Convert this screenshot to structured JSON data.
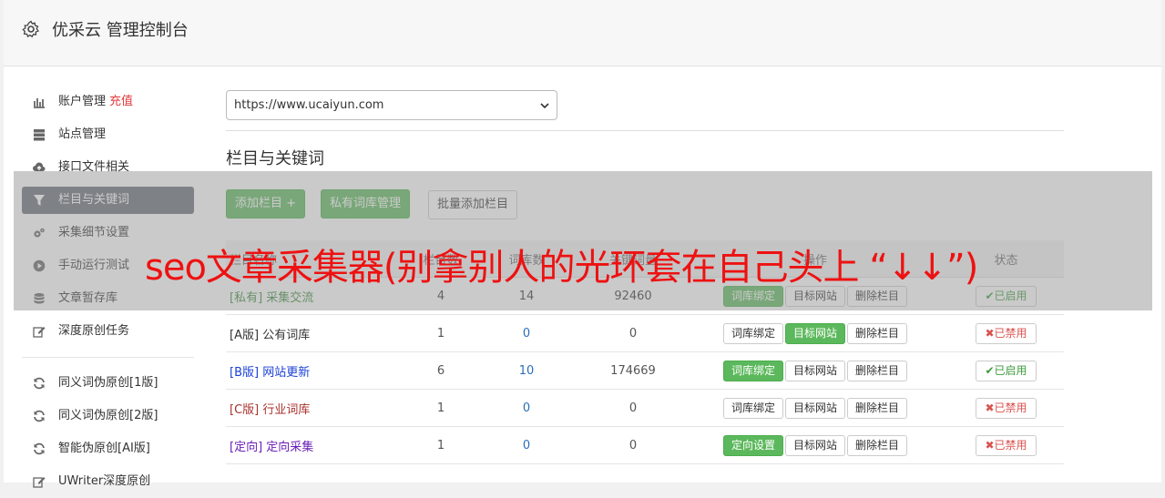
{
  "app": {
    "title": "优采云 管理控制台",
    "icon": "gear-icon"
  },
  "sidebar": {
    "items": [
      {
        "label": "账户管理",
        "extra": "充值",
        "icon": "bar-chart-icon"
      },
      {
        "label": "站点管理",
        "icon": "server-icon"
      },
      {
        "label": "接口文件相关",
        "icon": "cloud-upload-icon"
      },
      {
        "label": "栏目与关键词",
        "icon": "filter-icon",
        "active": true
      },
      {
        "label": "采集细节设置",
        "icon": "cogs-icon"
      },
      {
        "label": "手动运行测试",
        "icon": "play-circle-icon"
      },
      {
        "label": "文章暂存库",
        "icon": "database-icon"
      },
      {
        "label": "深度原创任务",
        "icon": "edit-icon"
      }
    ],
    "items2": [
      {
        "label": "同义词伪原创[1版]",
        "icon": "refresh-icon"
      },
      {
        "label": "同义词伪原创[2版]",
        "icon": "refresh-icon"
      },
      {
        "label": "智能伪原创[AI版]",
        "icon": "refresh-icon"
      },
      {
        "label": "UWriter深度原创",
        "icon": "edit-icon"
      }
    ]
  },
  "site_select": {
    "value": "https://www.ucaiyun.com"
  },
  "section_title": "栏目与关键词",
  "buttons": {
    "add_column": "添加栏目 +",
    "private_lib": "私有词库管理",
    "batch_add": "批量添加栏目"
  },
  "table": {
    "headers": {
      "name": "栏目名称",
      "c2": "栏目数",
      "c3": "词库数",
      "c4": "关键词量",
      "ops": "操作",
      "status": "状态"
    },
    "rows": [
      {
        "tag": "[私有]",
        "name": "采集交流",
        "a": "4",
        "b": "14",
        "c": "92460",
        "op1": "词库绑定",
        "op2": "目标网站",
        "op3": "删除栏目",
        "status": "已启用",
        "color": "#3c8b3c"
      },
      {
        "tag": "[A版]",
        "name": "公有词库",
        "a": "1",
        "b": "0",
        "c": "0",
        "op1": "词库绑定",
        "op2": "目标网站",
        "op3": "删除栏目",
        "status": "已禁用",
        "color": "#333333"
      },
      {
        "tag": "[B版]",
        "name": "网站更新",
        "a": "6",
        "b": "10",
        "c": "174669",
        "op1": "词库绑定",
        "op2": "目标网站",
        "op3": "删除栏目",
        "status": "已启用",
        "color": "#1a3fd6"
      },
      {
        "tag": "[C版]",
        "name": "行业词库",
        "a": "1",
        "b": "0",
        "c": "0",
        "op1": "词库绑定",
        "op2": "目标网站",
        "op3": "删除栏目",
        "status": "已禁用",
        "color": "#a8322d"
      },
      {
        "tag": "[定向]",
        "name": "定向采集",
        "a": "1",
        "b": "0",
        "c": "0",
        "op1": "定向设置",
        "op2": "目标网站",
        "op3": "删除栏目",
        "status": "已禁用",
        "color": "#6a1fb5"
      }
    ]
  },
  "headline": "seo文章采集器(别拿别人的光环套在自己头上 “↓↓”)",
  "colors": {
    "green": "#5cb85c",
    "active_side": "#666e79",
    "headline": "#ee1111"
  }
}
